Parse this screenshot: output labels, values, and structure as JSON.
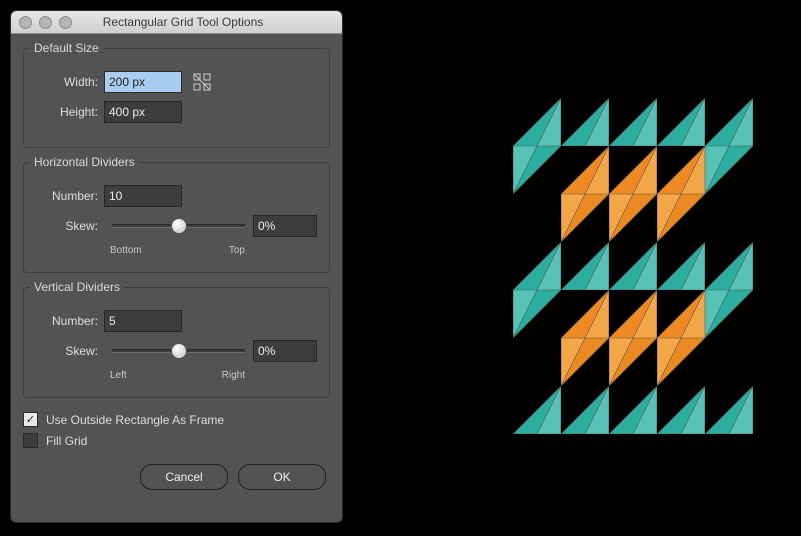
{
  "dialog": {
    "title": "Rectangular Grid Tool Options",
    "defaultSize": {
      "heading": "Default Size",
      "widthLabel": "Width:",
      "widthValue": "200 px",
      "heightLabel": "Height:",
      "heightValue": "400 px"
    },
    "horizontal": {
      "heading": "Horizontal Dividers",
      "numberLabel": "Number:",
      "numberValue": "10",
      "skewLabel": "Skew:",
      "skewValue": "0%",
      "lowLabel": "Bottom",
      "highLabel": "Top"
    },
    "vertical": {
      "heading": "Vertical Dividers",
      "numberLabel": "Number:",
      "numberValue": "5",
      "skewLabel": "Skew:",
      "skewValue": "0%",
      "lowLabel": "Left",
      "highLabel": "Right"
    },
    "useOutside": {
      "checked": true,
      "label": "Use Outside Rectangle As Frame"
    },
    "fillGrid": {
      "checked": false,
      "label": "Fill Grid"
    },
    "cancel": "Cancel",
    "ok": "OK"
  },
  "artwork": {
    "cellSize": 48,
    "cols": 5,
    "rows": 7,
    "colors": {
      "teal": "#2aae9f",
      "tealLight": "#55c2b5",
      "orange": "#ef8a23",
      "orangeLight": "#f4a749"
    },
    "pattern": [
      {
        "r": 0,
        "c": 0,
        "color": "teal",
        "shape": "upper-right"
      },
      {
        "r": 0,
        "c": 1,
        "color": "teal",
        "shape": "upper-right"
      },
      {
        "r": 0,
        "c": 2,
        "color": "teal",
        "shape": "upper-right"
      },
      {
        "r": 0,
        "c": 3,
        "color": "teal",
        "shape": "upper-right"
      },
      {
        "r": 0,
        "c": 4,
        "color": "teal",
        "shape": "upper-right"
      },
      {
        "r": 1,
        "c": 0,
        "color": "teal",
        "shape": "lower-left"
      },
      {
        "r": 1,
        "c": 1,
        "color": "orange",
        "shape": "upper-right"
      },
      {
        "r": 1,
        "c": 2,
        "color": "orange",
        "shape": "upper-right"
      },
      {
        "r": 1,
        "c": 3,
        "color": "orange",
        "shape": "upper-right"
      },
      {
        "r": 1,
        "c": 4,
        "color": "teal",
        "shape": "lower-left"
      },
      {
        "r": 2,
        "c": 1,
        "color": "orange",
        "shape": "lower-left"
      },
      {
        "r": 2,
        "c": 2,
        "color": "orange",
        "shape": "lower-left"
      },
      {
        "r": 2,
        "c": 3,
        "color": "orange",
        "shape": "lower-left"
      },
      {
        "r": 3,
        "c": 0,
        "color": "teal",
        "shape": "upper-right"
      },
      {
        "r": 3,
        "c": 1,
        "color": "teal",
        "shape": "upper-right"
      },
      {
        "r": 3,
        "c": 2,
        "color": "teal",
        "shape": "upper-right"
      },
      {
        "r": 3,
        "c": 3,
        "color": "teal",
        "shape": "upper-right"
      },
      {
        "r": 3,
        "c": 4,
        "color": "teal",
        "shape": "upper-right"
      },
      {
        "r": 4,
        "c": 0,
        "color": "teal",
        "shape": "lower-left"
      },
      {
        "r": 4,
        "c": 1,
        "color": "orange",
        "shape": "upper-right"
      },
      {
        "r": 4,
        "c": 2,
        "color": "orange",
        "shape": "upper-right"
      },
      {
        "r": 4,
        "c": 3,
        "color": "orange",
        "shape": "upper-right"
      },
      {
        "r": 4,
        "c": 4,
        "color": "teal",
        "shape": "lower-left"
      },
      {
        "r": 5,
        "c": 1,
        "color": "orange",
        "shape": "lower-left"
      },
      {
        "r": 5,
        "c": 2,
        "color": "orange",
        "shape": "lower-left"
      },
      {
        "r": 5,
        "c": 3,
        "color": "orange",
        "shape": "lower-left"
      },
      {
        "r": 6,
        "c": 0,
        "color": "teal",
        "shape": "upper-right"
      },
      {
        "r": 6,
        "c": 1,
        "color": "teal",
        "shape": "upper-right"
      },
      {
        "r": 6,
        "c": 2,
        "color": "teal",
        "shape": "upper-right"
      },
      {
        "r": 6,
        "c": 3,
        "color": "teal",
        "shape": "upper-right"
      },
      {
        "r": 6,
        "c": 4,
        "color": "teal",
        "shape": "upper-right"
      }
    ]
  }
}
